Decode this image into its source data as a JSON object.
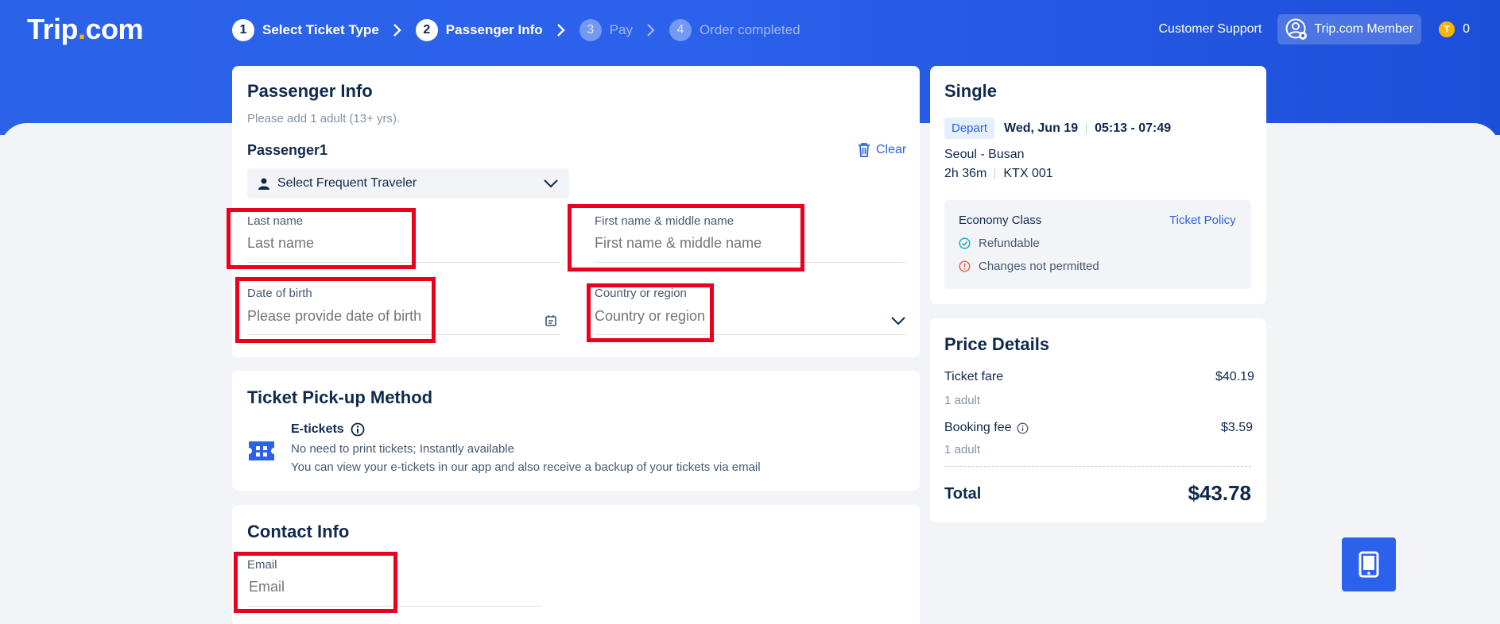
{
  "header": {
    "logo_text": "Trip",
    "logo_dot": ".",
    "logo_suffix": "com",
    "steps": [
      {
        "num": "1",
        "label": "Select Ticket Type"
      },
      {
        "num": "2",
        "label": "Passenger Info"
      },
      {
        "num": "3",
        "label": "Pay"
      },
      {
        "num": "4",
        "label": "Order completed"
      }
    ],
    "support": "Customer Support",
    "member": "Trip.com Member",
    "coin_icon": "T",
    "coins": "0"
  },
  "passenger": {
    "title": "Passenger Info",
    "subtitle": "Please add 1 adult (13+ yrs).",
    "passenger_label": "Passenger1",
    "clear": "Clear",
    "select_traveler": "Select Frequent Traveler",
    "last_name_label": "Last name",
    "last_name_placeholder": "Last name",
    "first_name_label": "First name & middle name",
    "first_name_placeholder": "First name & middle name",
    "dob_label": "Date of birth",
    "dob_placeholder": "Please provide date of birth",
    "country_label": "Country or region",
    "country_placeholder": "Country or region"
  },
  "pickup": {
    "title": "Ticket Pick-up Method",
    "method": "E-tickets",
    "line1": "No need to print tickets; Instantly available",
    "line2": "You can view your e-tickets in our app and also receive a backup of your tickets via email"
  },
  "contact": {
    "title": "Contact Info",
    "email_label": "Email",
    "email_placeholder": "Email"
  },
  "summary": {
    "title": "Single",
    "tag": "Depart",
    "date": "Wed, Jun 19",
    "time": "05:13 - 07:49",
    "route": "Seoul - Busan",
    "duration": "2h 36m",
    "train": "KTX 001",
    "class": "Economy Class",
    "policy_link": "Ticket Policy",
    "refundable": "Refundable",
    "changes": "Changes not permitted"
  },
  "price": {
    "title": "Price Details",
    "ticket_fare_label": "Ticket fare",
    "ticket_fare": "$40.19",
    "ticket_qty": "1 adult",
    "booking_fee_label": "Booking fee",
    "booking_fee": "$3.59",
    "booking_qty": "1 adult",
    "total_label": "Total",
    "total": "$43.78"
  },
  "colors": {
    "brand": "#2c61ec",
    "highlight": "#e8001c",
    "coin": "#ffb400"
  }
}
